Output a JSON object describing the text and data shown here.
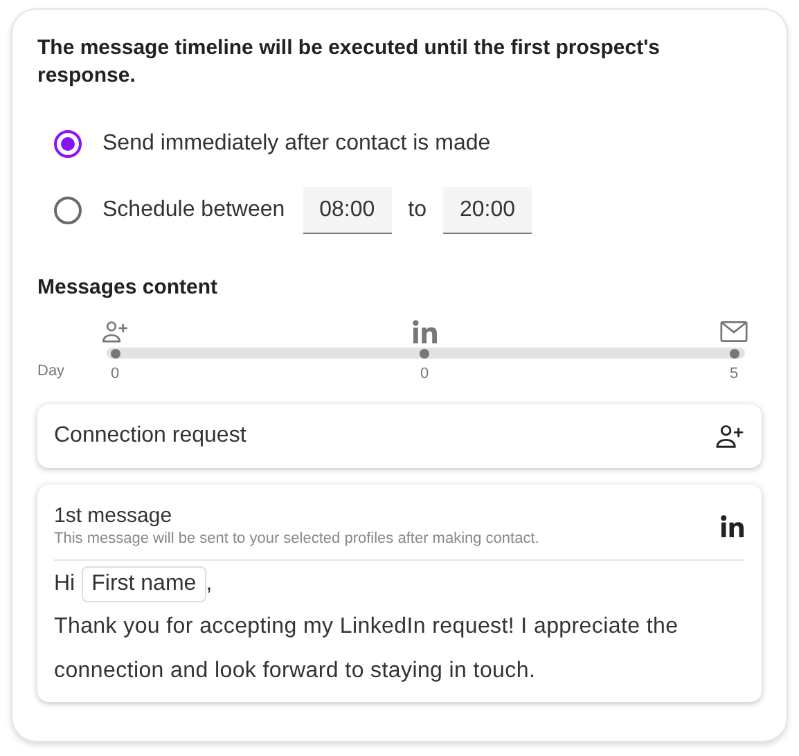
{
  "notice": "The message timeline will be executed until the first prospect's response.",
  "send_options": [
    {
      "kind": "plain",
      "label": "Send immediately after contact is made",
      "selected": true
    },
    {
      "kind": "schedule",
      "label": "Schedule between",
      "from": "08:00",
      "separator": "to",
      "to": "20:00",
      "selected": false
    }
  ],
  "messages_content": {
    "title": "Messages content",
    "day_label": "Day",
    "steps": [
      {
        "kind": "connect",
        "day": "0"
      },
      {
        "kind": "linkedin",
        "day": "0"
      },
      {
        "kind": "email",
        "day": "5"
      }
    ]
  },
  "cards": [
    {
      "kind": "connect",
      "title": "Connection request"
    },
    {
      "kind": "linkedin",
      "title": "1st message",
      "subtitle": "This message will be sent to your selected profiles after making contact.",
      "greeting": "Hi",
      "variable": "First name",
      "greeting_end": ",",
      "body": "Thank you for accepting my LinkedIn request! I appreciate the connection and look forward to staying in touch."
    }
  ]
}
